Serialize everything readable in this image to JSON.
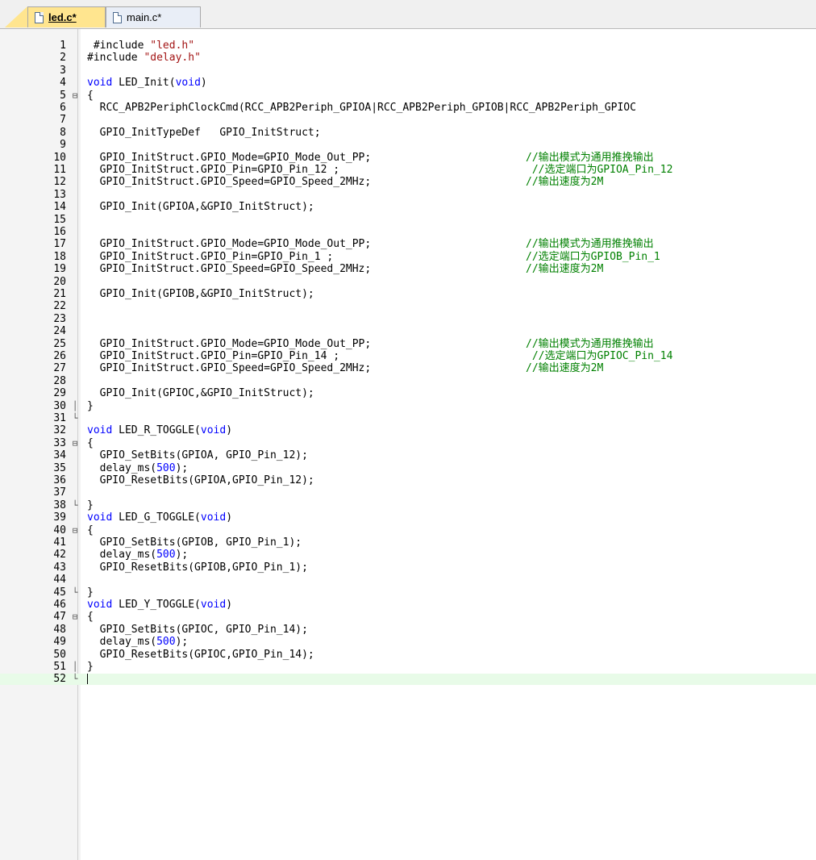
{
  "tabs": [
    {
      "label": "led.c*",
      "active": true
    },
    {
      "label": "main.c*",
      "active": false
    }
  ],
  "lines": [
    {
      "n": "1",
      "fold": "",
      "code": [
        {
          "t": " #include "
        },
        {
          "t": "\"led.h\"",
          "c": "str"
        }
      ],
      "comment": ""
    },
    {
      "n": "2",
      "fold": "",
      "code": [
        {
          "t": "#include "
        },
        {
          "t": "\"delay.h\"",
          "c": "str"
        }
      ],
      "comment": ""
    },
    {
      "n": "3",
      "fold": "",
      "code": [],
      "comment": ""
    },
    {
      "n": "4",
      "fold": "",
      "code": [
        {
          "t": "void",
          "c": "kw"
        },
        {
          "t": " LED_Init("
        },
        {
          "t": "void",
          "c": "kw"
        },
        {
          "t": ")"
        }
      ],
      "comment": ""
    },
    {
      "n": "5",
      "fold": "⊟",
      "code": [
        {
          "t": "{"
        }
      ],
      "comment": ""
    },
    {
      "n": "6",
      "fold": "",
      "code": [
        {
          "t": "  RCC_APB2PeriphClockCmd(RCC_APB2Periph_GPIOA|RCC_APB2Periph_GPIOB|RCC_APB2Periph_GPIOC"
        }
      ],
      "comment": ""
    },
    {
      "n": "7",
      "fold": "",
      "code": [],
      "comment": ""
    },
    {
      "n": "8",
      "fold": "",
      "code": [
        {
          "t": "  GPIO_InitTypeDef   GPIO_InitStruct;"
        }
      ],
      "comment": ""
    },
    {
      "n": "9",
      "fold": "",
      "code": [],
      "comment": ""
    },
    {
      "n": "10",
      "fold": "",
      "code": [
        {
          "t": "  GPIO_InitStruct.GPIO_Mode=GPIO_Mode_Out_PP;"
        }
      ],
      "comment": "//输出模式为通用推挽输出"
    },
    {
      "n": "11",
      "fold": "",
      "code": [
        {
          "t": "  GPIO_InitStruct.GPIO_Pin=GPIO_Pin_12 ;"
        }
      ],
      "comment": " //选定端口为GPIOA_Pin_12"
    },
    {
      "n": "12",
      "fold": "",
      "code": [
        {
          "t": "  GPIO_InitStruct.GPIO_Speed=GPIO_Speed_2MHz;"
        }
      ],
      "comment": "//输出速度为2M"
    },
    {
      "n": "13",
      "fold": "",
      "code": [],
      "comment": ""
    },
    {
      "n": "14",
      "fold": "",
      "code": [
        {
          "t": "  GPIO_Init(GPIOA,&GPIO_InitStruct);"
        }
      ],
      "comment": ""
    },
    {
      "n": "15",
      "fold": "",
      "code": [],
      "comment": ""
    },
    {
      "n": "16",
      "fold": "",
      "code": [],
      "comment": ""
    },
    {
      "n": "17",
      "fold": "",
      "code": [
        {
          "t": "  GPIO_InitStruct.GPIO_Mode=GPIO_Mode_Out_PP;"
        }
      ],
      "comment": "//输出模式为通用推挽输出"
    },
    {
      "n": "18",
      "fold": "",
      "code": [
        {
          "t": "  GPIO_InitStruct.GPIO_Pin=GPIO_Pin_1 ;"
        }
      ],
      "comment": "//选定端口为GPIOB_Pin_1"
    },
    {
      "n": "19",
      "fold": "",
      "code": [
        {
          "t": "  GPIO_InitStruct.GPIO_Speed=GPIO_Speed_2MHz;"
        }
      ],
      "comment": "//输出速度为2M"
    },
    {
      "n": "20",
      "fold": "",
      "code": [],
      "comment": ""
    },
    {
      "n": "21",
      "fold": "",
      "code": [
        {
          "t": "  GPIO_Init(GPIOB,&GPIO_InitStruct);"
        }
      ],
      "comment": ""
    },
    {
      "n": "22",
      "fold": "",
      "code": [],
      "comment": ""
    },
    {
      "n": "23",
      "fold": "",
      "code": [],
      "comment": ""
    },
    {
      "n": "24",
      "fold": "",
      "code": [],
      "comment": ""
    },
    {
      "n": "25",
      "fold": "",
      "code": [
        {
          "t": "  GPIO_InitStruct.GPIO_Mode=GPIO_Mode_Out_PP;"
        }
      ],
      "comment": "//输出模式为通用推挽输出"
    },
    {
      "n": "26",
      "fold": "",
      "code": [
        {
          "t": "  GPIO_InitStruct.GPIO_Pin=GPIO_Pin_14 ;"
        }
      ],
      "comment": " //选定端口为GPIOC_Pin_14"
    },
    {
      "n": "27",
      "fold": "",
      "code": [
        {
          "t": "  GPIO_InitStruct.GPIO_Speed=GPIO_Speed_2MHz;"
        }
      ],
      "comment": "//输出速度为2M"
    },
    {
      "n": "28",
      "fold": "",
      "code": [],
      "comment": ""
    },
    {
      "n": "29",
      "fold": "",
      "code": [
        {
          "t": "  GPIO_Init(GPIOC,&GPIO_InitStruct);"
        }
      ],
      "comment": ""
    },
    {
      "n": "30",
      "fold": "│",
      "code": [
        {
          "t": "}"
        }
      ],
      "comment": ""
    },
    {
      "n": "31",
      "fold": "└",
      "code": [],
      "comment": ""
    },
    {
      "n": "32",
      "fold": "",
      "code": [
        {
          "t": "void",
          "c": "kw"
        },
        {
          "t": " LED_R_TOGGLE("
        },
        {
          "t": "void",
          "c": "kw"
        },
        {
          "t": ")"
        }
      ],
      "comment": ""
    },
    {
      "n": "33",
      "fold": "⊟",
      "code": [
        {
          "t": "{"
        }
      ],
      "comment": ""
    },
    {
      "n": "34",
      "fold": "",
      "code": [
        {
          "t": "  GPIO_SetBits(GPIOA, GPIO_Pin_12);"
        }
      ],
      "comment": ""
    },
    {
      "n": "35",
      "fold": "",
      "code": [
        {
          "t": "  delay_ms("
        },
        {
          "t": "500",
          "c": "num"
        },
        {
          "t": ");"
        }
      ],
      "comment": ""
    },
    {
      "n": "36",
      "fold": "",
      "code": [
        {
          "t": "  GPIO_ResetBits(GPIOA,GPIO_Pin_12);"
        }
      ],
      "comment": ""
    },
    {
      "n": "37",
      "fold": "",
      "code": [],
      "comment": ""
    },
    {
      "n": "38",
      "fold": "└",
      "code": [
        {
          "t": "}"
        }
      ],
      "comment": ""
    },
    {
      "n": "39",
      "fold": "",
      "code": [
        {
          "t": "void",
          "c": "kw"
        },
        {
          "t": " LED_G_TOGGLE("
        },
        {
          "t": "void",
          "c": "kw"
        },
        {
          "t": ")"
        }
      ],
      "comment": ""
    },
    {
      "n": "40",
      "fold": "⊟",
      "code": [
        {
          "t": "{"
        }
      ],
      "comment": ""
    },
    {
      "n": "41",
      "fold": "",
      "code": [
        {
          "t": "  GPIO_SetBits(GPIOB, GPIO_Pin_1);"
        }
      ],
      "comment": ""
    },
    {
      "n": "42",
      "fold": "",
      "code": [
        {
          "t": "  delay_ms("
        },
        {
          "t": "500",
          "c": "num"
        },
        {
          "t": ");"
        }
      ],
      "comment": ""
    },
    {
      "n": "43",
      "fold": "",
      "code": [
        {
          "t": "  GPIO_ResetBits(GPIOB,GPIO_Pin_1);"
        }
      ],
      "comment": ""
    },
    {
      "n": "44",
      "fold": "",
      "code": [],
      "comment": ""
    },
    {
      "n": "45",
      "fold": "└",
      "code": [
        {
          "t": "}"
        }
      ],
      "comment": ""
    },
    {
      "n": "46",
      "fold": "",
      "code": [
        {
          "t": "void",
          "c": "kw"
        },
        {
          "t": " LED_Y_TOGGLE("
        },
        {
          "t": "void",
          "c": "kw"
        },
        {
          "t": ")"
        }
      ],
      "comment": ""
    },
    {
      "n": "47",
      "fold": "⊟",
      "code": [
        {
          "t": "{"
        }
      ],
      "comment": ""
    },
    {
      "n": "48",
      "fold": "",
      "code": [
        {
          "t": "  GPIO_SetBits(GPIOC, GPIO_Pin_14);"
        }
      ],
      "comment": ""
    },
    {
      "n": "49",
      "fold": "",
      "code": [
        {
          "t": "  delay_ms("
        },
        {
          "t": "500",
          "c": "num"
        },
        {
          "t": ");"
        }
      ],
      "comment": ""
    },
    {
      "n": "50",
      "fold": "",
      "code": [
        {
          "t": "  GPIO_ResetBits(GPIOC,GPIO_Pin_14);"
        }
      ],
      "comment": ""
    },
    {
      "n": "51",
      "fold": "│",
      "code": [
        {
          "t": "}"
        }
      ],
      "comment": ""
    },
    {
      "n": "52",
      "fold": "└",
      "code": [],
      "comment": "",
      "current": true
    }
  ],
  "colors": {
    "keyword": "#0000ff",
    "string": "#a31515",
    "comment": "#008000",
    "active_tab": "#ffe58f",
    "current_line": "#e8fbe8"
  }
}
